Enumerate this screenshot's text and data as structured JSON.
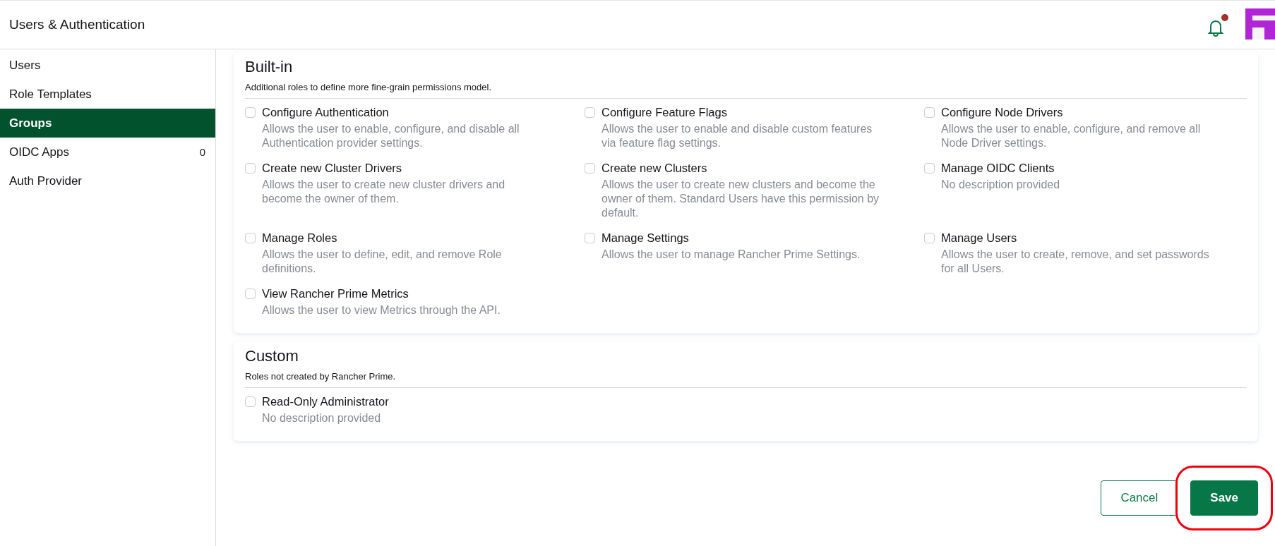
{
  "header": {
    "title": "Users & Authentication",
    "notifications": {
      "unread": true
    }
  },
  "sidebar": {
    "items": [
      {
        "label": "Users",
        "selected": false
      },
      {
        "label": "Role Templates",
        "selected": false
      },
      {
        "label": "Groups",
        "selected": true
      },
      {
        "label": "OIDC Apps",
        "count": "0",
        "selected": false
      },
      {
        "label": "Auth Provider",
        "selected": false
      }
    ]
  },
  "sections": [
    {
      "title": "Built-in",
      "description": "Additional roles to define more fine-grain permissions model.",
      "roles": [
        {
          "label": "Configure Authentication",
          "description": "Allows the user to enable, configure, and disable all Authentication provider settings.",
          "checked": false
        },
        {
          "label": "Configure Feature Flags",
          "description": "Allows the user to enable and disable custom features via feature flag settings.",
          "checked": false
        },
        {
          "label": "Configure Node Drivers",
          "description": "Allows the user to enable, configure, and remove all Node Driver settings.",
          "checked": false
        },
        {
          "label": "Create new Cluster Drivers",
          "description": "Allows the user to create new cluster drivers and become the owner of them.",
          "checked": false
        },
        {
          "label": "Create new Clusters",
          "description": "Allows the user to create new clusters and become the owner of them. Standard Users have this permission by default.",
          "checked": false
        },
        {
          "label": "Manage OIDC Clients",
          "description": "No description provided",
          "checked": false
        },
        {
          "label": "Manage Roles",
          "description": "Allows the user to define, edit, and remove Role definitions.",
          "checked": false
        },
        {
          "label": "Manage Settings",
          "description": "Allows the user to manage Rancher Prime Settings.",
          "checked": false
        },
        {
          "label": "Manage Users",
          "description": "Allows the user to create, remove, and set passwords for all Users.",
          "checked": false
        },
        {
          "label": "View Rancher Prime Metrics",
          "description": "Allows the user to view Metrics through the API.",
          "checked": false
        }
      ]
    },
    {
      "title": "Custom",
      "description": "Roles not created by Rancher Prime.",
      "roles": [
        {
          "label": "Read-Only Administrator",
          "description": "No description provided",
          "checked": false
        }
      ]
    }
  ],
  "buttons": [
    {
      "label": "Cancel",
      "kind": "secondary",
      "highlighted": false
    },
    {
      "label": "Save",
      "kind": "primary",
      "highlighted": true
    }
  ]
}
